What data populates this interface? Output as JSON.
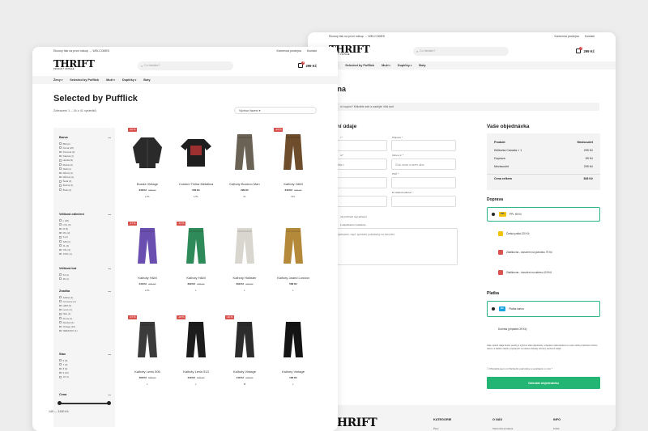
{
  "colors": {
    "accent": "#22b573",
    "sale": "#d9534f"
  },
  "back": {
    "topbar": {
      "left": "Ekosný tisk na prvni nákup → WELCOME5",
      "right": [
        "Kamenná prodejna",
        "Kontakt"
      ]
    },
    "search_placeholder": "Co hledáte?",
    "cart_price": "299 Kč",
    "nav": [
      "Ženy",
      "Selected by Pufflick",
      "Muži",
      "Doplňky",
      "Boty"
    ],
    "title": "adna",
    "notice": "ní kupón? Klikněte zde a zadejte Váš kód",
    "billing_heading": "rační údaje",
    "labels": {
      "surname": "Příjmení *",
      "country": "ni *",
      "street": "Ulice a č. *",
      "psc": "PSČ *",
      "email": "E-mailová adresa *",
      "phone": "Telefon *",
      "ship": "ná (rozhraní nejí adresu)",
      "note": "k objednávce (volitelné)"
    },
    "inputs": {
      "country": "ká republika",
      "street": "Číslo domu a název ulice",
      "note": "k Vaší objednávce, např. speciální požadavky na doručení."
    },
    "order_heading": "Vaše objednávka",
    "summary": {
      "h": [
        "Produkt",
        "Mezisoučet"
      ],
      "rows": [
        [
          "Kšiltovka Canada × 1",
          "299 Kč"
        ],
        [
          "Doprava",
          "69 Kč"
        ],
        [
          "Mezisoučet",
          "299 Kč"
        ]
      ],
      "total": [
        "Cena celkem",
        "368 Kč"
      ]
    },
    "shipping_heading": "Doprava",
    "shipping": [
      "PPL 69 Kč",
      "Česká pošta 120 Kč",
      "Zásilkovna - doručení na pobočku 79 Kč",
      "Zásilkovna - doručení na adresu 119 Kč"
    ],
    "payment_heading": "Platba",
    "payment": [
      "Platba kartou",
      "Dobírka (příplatek 39 Kč)"
    ],
    "terms": "Vaše osobní údaje budou použity k vyřízení Vaší objednávky, vylepšení zjednodušení po celou dobu procházení tohoto webu a k dalším účelům popsaných na stránce Zásady ochrany osobních údajů.",
    "agree": "Přečetl/a jsem si Obchodní podmínky a souhlasím s nimi *",
    "order_button": "Odeslat objednávku",
    "footer": {
      "cols": [
        "KATEGORIE",
        "O NÁS",
        "INFO"
      ],
      "items": [
        "Ženy",
        "Kamenná prodejna",
        "Košík"
      ]
    }
  },
  "front": {
    "topbar": {
      "left": "Ekosný tisk na prvni nákup → WELCOME5",
      "right": [
        "Kamenná prodejna",
        "Kontakt"
      ]
    },
    "search_placeholder": "Co hledáte?",
    "cart_price": "299 Kč",
    "nav": [
      "Ženy",
      "Selected by Pufflick",
      "Muži",
      "Doplňky",
      "Boty"
    ],
    "title": "Selected by Pufflick",
    "count": "Zobrazení 1 – 16 z 41 výsledků",
    "sort": "Výchozí řazení",
    "filters": [
      {
        "h": "Barva",
        "items": [
          "Bílá (1)",
          "Černá (25)",
          "Červená (3)",
          "Fialová (1)",
          "Hnědá (9)",
          "Modrá (4)",
          "Multi (1)",
          "Různá (1)",
          "Růžová (1)",
          "Šedá (2)",
          "Zelená (1)",
          "Žlutá (1)"
        ]
      },
      {
        "h": "Velikost oblečení",
        "items": [
          "L (18)",
          "L/XL (4)",
          "M (5)",
          "M/L (2)",
          "S (2)",
          "S/M (1)",
          "XL (4)",
          "XXL (3)",
          "XXXL (1)"
        ]
      },
      {
        "h": "Velikost bot",
        "items": [
          "44 (1)",
          "45 (1)"
        ]
      },
      {
        "h": "Značka",
        "items": [
          "Adidas (1)",
          "Converse (1)",
          "H&M (3)",
          "Levi's (1)",
          "Nike (1)",
          "Puma (1)",
          "Reebok (1)",
          "Vintage (24)",
          "WEEKDAY (1)"
        ]
      },
      {
        "h": "Stav",
        "items": [
          "5 (3)",
          "7 (3)",
          "8 (4)",
          "9 (10)",
          "10 (1)"
        ]
      },
      {
        "h": "Cena",
        "items": []
      }
    ],
    "price_range": "145  —  1190  Kč",
    "products": [
      {
        "sale": "-10 %",
        "name": "Bunda Vintage",
        "price": "349 Kč",
        "old": "399 Kč",
        "size": "L/XL",
        "shape": "jacket",
        "color": "#2a2a2a"
      },
      {
        "sale": "",
        "name": "Custom Trička Metallica",
        "price": "349 Kč",
        "old": "",
        "size": "L/XL",
        "shape": "tee",
        "color": "#1e1e1e"
      },
      {
        "sale": "",
        "name": "Kalhoty Boohoo Man",
        "price": "299 Kč",
        "old": "",
        "size": "XL",
        "shape": "pants",
        "color": "#6b6256"
      },
      {
        "sale": "-10 %",
        "name": "Kalhoty H&M",
        "price": "349 Kč",
        "old": "399 Kč",
        "size": "M/L",
        "shape": "pants",
        "color": "#6e4d2c"
      },
      {
        "sale": "-17 %",
        "name": "Kalhoty H&M",
        "price": "249 Kč",
        "old": "299 Kč",
        "size": "L/XL",
        "shape": "pants",
        "color": "#6a4fb0"
      },
      {
        "sale": "-14 %",
        "name": "Kalhoty H&M",
        "price": "299 Kč",
        "old": "349 Kč",
        "size": "L",
        "shape": "pants",
        "color": "#2f8a59"
      },
      {
        "sale": "",
        "name": "Kalhoty Hollister",
        "price": "299 Kč",
        "old": "349 Kč",
        "size": "L",
        "shape": "pants",
        "color": "#d9d6cf"
      },
      {
        "sale": "",
        "name": "Kalhoty Jaded London",
        "price": "599 Kč",
        "old": "",
        "size": "L",
        "shape": "pants",
        "color": "#b48a3a"
      },
      {
        "sale": "-17 %",
        "name": "Kalhoty Levis 505",
        "price": "499 Kč",
        "old": "599 Kč",
        "size": "L",
        "shape": "pants",
        "color": "#3b3b3b"
      },
      {
        "sale": "-18 %",
        "name": "Kalhoty Levis 513",
        "price": "449 Kč",
        "old": "549 Kč",
        "size": "L",
        "shape": "pants",
        "color": "#1c1c1c"
      },
      {
        "sale": "-40 %",
        "name": "Kalhoty Vintage",
        "price": "149 Kč",
        "old": "249 Kč",
        "size": "M",
        "shape": "pants",
        "color": "#2c2c2c"
      },
      {
        "sale": "",
        "name": "Kalhoty Vintage",
        "price": "199 Kč",
        "old": "",
        "size": "L",
        "shape": "pants",
        "color": "#141414"
      }
    ]
  }
}
